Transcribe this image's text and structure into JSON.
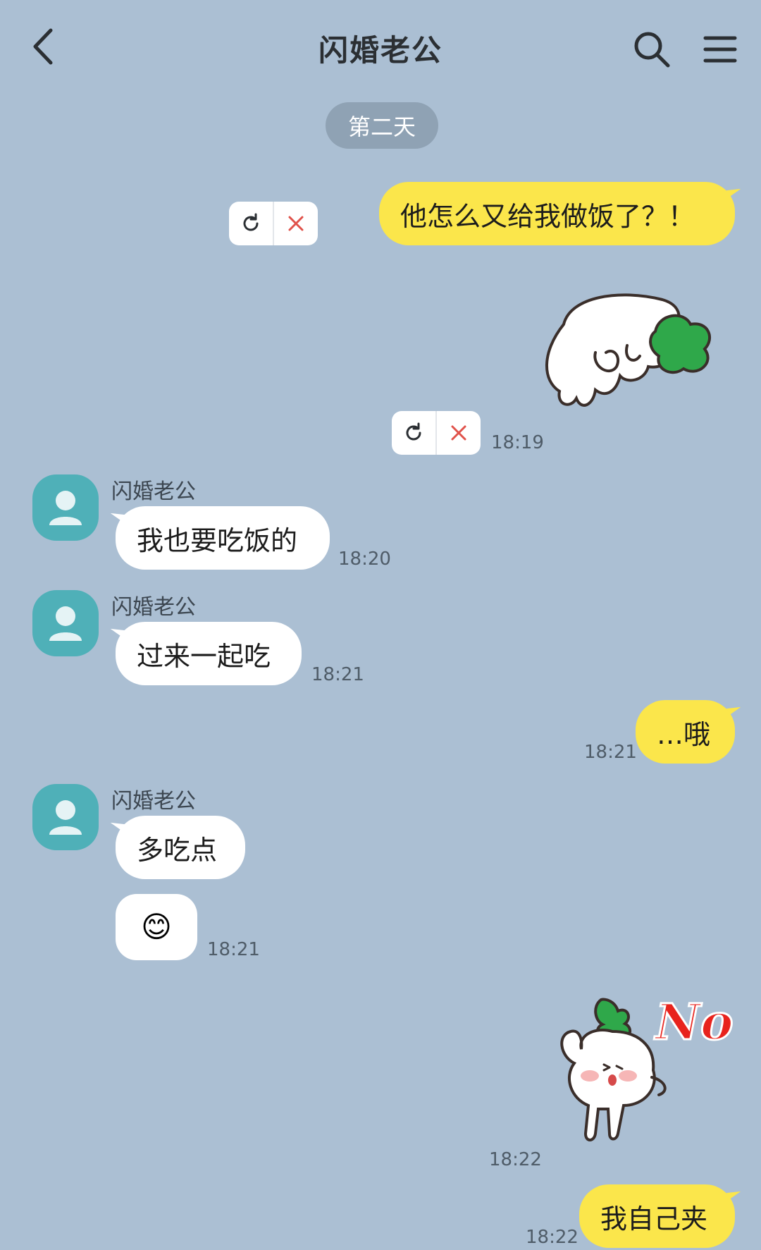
{
  "header": {
    "title": "闪婚老公",
    "back_icon": "back-arrow-icon",
    "search_icon": "search-icon",
    "menu_icon": "menu-icon"
  },
  "date_divider": "第二天",
  "messages": {
    "m1": {
      "text": "他怎么又给我做饭了？！"
    },
    "m2": {
      "time": "18:19",
      "sticker": "radish-sticker-hug"
    },
    "m3": {
      "sender": "闪婚老公",
      "text": "我也要吃饭的",
      "time": "18:20"
    },
    "m4": {
      "sender": "闪婚老公",
      "text": "过来一起吃",
      "time": "18:21"
    },
    "m5": {
      "text": "…哦",
      "time": "18:21"
    },
    "m6": {
      "sender": "闪婚老公",
      "text": "多吃点",
      "emoji": "😊",
      "time": "18:21"
    },
    "m7": {
      "time": "18:22",
      "sticker": "radish-sticker-no",
      "sticker_text": "No"
    },
    "m8": {
      "text": "我自己夹",
      "time": "18:22"
    }
  },
  "colors": {
    "background": "#abbfd3",
    "my_bubble": "#fbe64b",
    "their_bubble": "#ffffff",
    "avatar": "#4fb0b8",
    "error": "#e0524a"
  }
}
